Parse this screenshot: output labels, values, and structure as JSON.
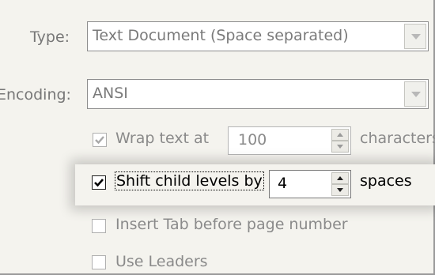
{
  "type_row": {
    "label": "Type:",
    "value": "Text Document (Space separated)"
  },
  "encoding_row": {
    "label": "Encoding:",
    "value": "ANSI"
  },
  "wrap_text": {
    "label": "Wrap text at",
    "checked": true,
    "enabled": false,
    "value": "100",
    "unit": "characters"
  },
  "shift_child": {
    "label": "Shift child levels by",
    "checked": true,
    "enabled": true,
    "value": "4",
    "unit": "spaces"
  },
  "insert_tab": {
    "label": "Insert Tab before page number",
    "checked": false,
    "enabled": false
  },
  "use_leaders": {
    "label": "Use Leaders",
    "checked": false,
    "enabled": false
  }
}
